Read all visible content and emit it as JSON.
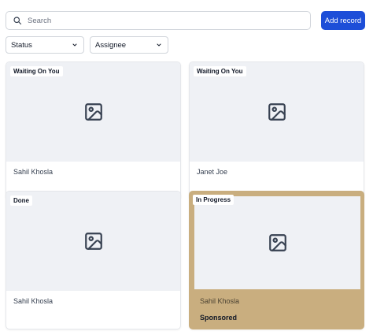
{
  "search": {
    "placeholder": "Search",
    "value": "",
    "icon": "search-icon"
  },
  "toolbar": {
    "add_label": "Add record",
    "accent": "#1d4ed8"
  },
  "filters": [
    {
      "label": "Status",
      "icon": "chevron-down-icon"
    },
    {
      "label": "Assignee",
      "icon": "chevron-down-icon"
    }
  ],
  "cards": [
    {
      "status": "Waiting On You",
      "name": "Sahil Khosla",
      "image": "image-placeholder-icon"
    },
    {
      "status": "Waiting On You",
      "name": "Janet Joe",
      "image": "image-placeholder-icon"
    },
    {
      "status": "Done",
      "name": "Sahil Khosla",
      "image": "image-placeholder-icon"
    },
    {
      "status": "In Progress",
      "name": "Sahil Khosla",
      "image": "image-placeholder-icon",
      "sponsored_label": "Sponsored",
      "highlight_color": "#c9ae7f"
    }
  ]
}
